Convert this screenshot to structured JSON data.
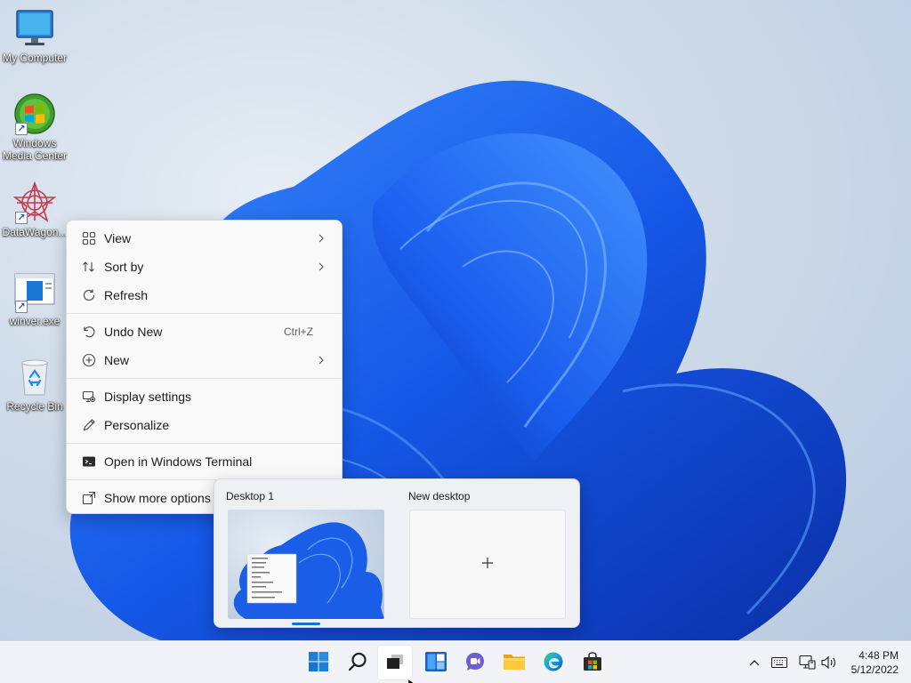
{
  "desktop_icons": [
    {
      "label": "My Computer",
      "icon": "monitor-icon"
    },
    {
      "label": "Windows Media Center",
      "icon": "windows-media-center-icon"
    },
    {
      "label": "DataWagon...",
      "icon": "datawagon-icon"
    },
    {
      "label": "winver.exe",
      "icon": "winver-icon"
    },
    {
      "label": "Recycle Bin",
      "icon": "recycle-bin-icon"
    }
  ],
  "context_menu": {
    "items": [
      {
        "label": "View",
        "icon": "grid-icon",
        "submenu": true
      },
      {
        "label": "Sort by",
        "icon": "sort-icon",
        "submenu": true
      },
      {
        "label": "Refresh",
        "icon": "refresh-icon"
      },
      {
        "label": "Undo New",
        "icon": "undo-icon",
        "shortcut": "Ctrl+Z"
      },
      {
        "label": "New",
        "icon": "plus-circle-icon",
        "submenu": true
      },
      {
        "label": "Display settings",
        "icon": "display-settings-icon"
      },
      {
        "label": "Personalize",
        "icon": "pen-icon"
      },
      {
        "label": "Open in Windows Terminal",
        "icon": "terminal-icon"
      },
      {
        "label": "Show more options",
        "icon": "more-options-icon"
      }
    ]
  },
  "task_view": {
    "desktops": [
      {
        "title": "Desktop 1",
        "active": true
      },
      {
        "title": "New desktop",
        "icon": "plus-icon"
      }
    ]
  },
  "taskbar": {
    "apps": [
      {
        "name": "Start",
        "icon": "windows-start-icon"
      },
      {
        "name": "Search",
        "icon": "search-icon"
      },
      {
        "name": "Task View",
        "icon": "task-view-icon",
        "active": true
      },
      {
        "name": "Widgets",
        "icon": "widgets-icon"
      },
      {
        "name": "Chat",
        "icon": "chat-icon"
      },
      {
        "name": "File Explorer",
        "icon": "folder-icon"
      },
      {
        "name": "Microsoft Edge",
        "icon": "edge-icon"
      },
      {
        "name": "Microsoft Store",
        "icon": "store-icon"
      }
    ],
    "tray": [
      "chevron-up-icon",
      "keyboard-icon",
      "network-icon",
      "volume-icon"
    ],
    "clock": {
      "time": "4:48 PM",
      "date": "5/12/2022"
    }
  },
  "colors": {
    "accent": "#0067c0",
    "bloom": "#1457d9",
    "menu_bg": "#f9f9f9",
    "taskbar_bg": "#f1f3f6"
  }
}
